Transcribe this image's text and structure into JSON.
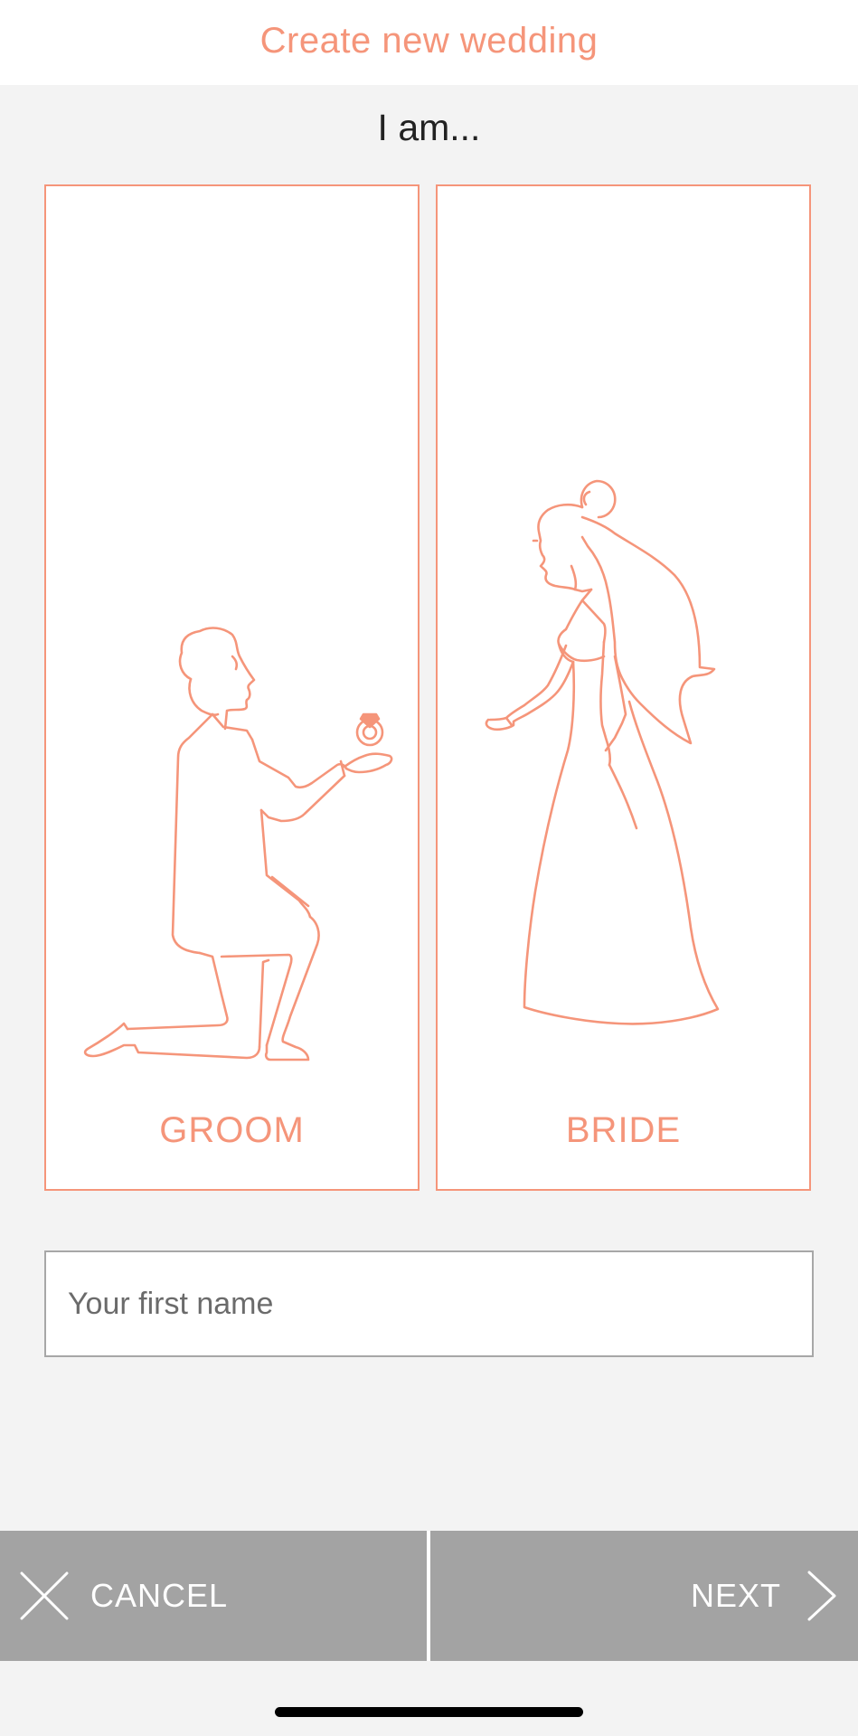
{
  "header": {
    "title": "Create new wedding"
  },
  "prompt": {
    "text": "I am..."
  },
  "roles": {
    "groom_label": "GROOM",
    "bride_label": "BRIDE"
  },
  "name_field": {
    "placeholder": "Your first name",
    "value": ""
  },
  "footer": {
    "cancel_label": "CANCEL",
    "next_label": "NEXT",
    "cancel_icon": "close-icon",
    "next_icon": "chevron-right-icon"
  },
  "colors": {
    "accent": "#f5957a",
    "footer_bg": "#a3a3a3",
    "page_bg": "#f3f3f3"
  }
}
